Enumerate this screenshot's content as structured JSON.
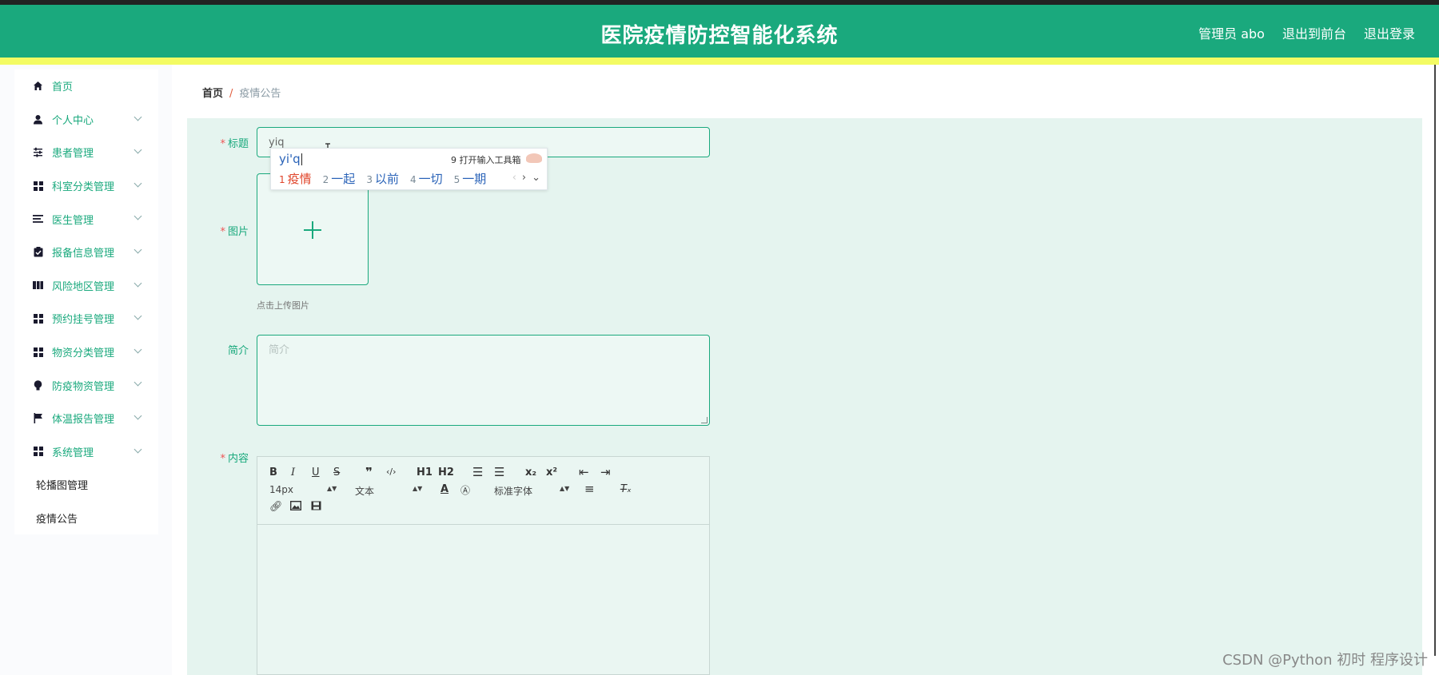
{
  "header": {
    "title": "医院疫情防控智能化系统",
    "nav": [
      "管理员 abo",
      "退出到前台",
      "退出登录"
    ]
  },
  "sidebar": {
    "items": [
      {
        "label": "首页",
        "icon": "home-icon",
        "has_children": false
      },
      {
        "label": "个人中心",
        "icon": "user-icon",
        "has_children": true
      },
      {
        "label": "患者管理",
        "icon": "sliders-icon",
        "has_children": true
      },
      {
        "label": "科室分类管理",
        "icon": "grid-icon",
        "has_children": true
      },
      {
        "label": "医生管理",
        "icon": "list-icon",
        "has_children": true
      },
      {
        "label": "报备信息管理",
        "icon": "clipboard-check-icon",
        "has_children": true
      },
      {
        "label": "风险地区管理",
        "icon": "map-icon",
        "has_children": true
      },
      {
        "label": "预约挂号管理",
        "icon": "grid-icon",
        "has_children": true
      },
      {
        "label": "物资分类管理",
        "icon": "grid-icon",
        "has_children": true
      },
      {
        "label": "防疫物资管理",
        "icon": "bulb-icon",
        "has_children": true
      },
      {
        "label": "体温报告管理",
        "icon": "flag-icon",
        "has_children": true
      },
      {
        "label": "系统管理",
        "icon": "grid-icon",
        "has_children": true
      }
    ],
    "sub_items": [
      "轮播图管理",
      "疫情公告"
    ]
  },
  "breadcrumb": {
    "home": "首页",
    "separator": "/",
    "current": "疫情公告"
  },
  "form": {
    "title_label": "标题",
    "title_value": "yiq",
    "image_label": "图片",
    "upload_tip": "点击上传图片",
    "summary_label": "简介",
    "summary_placeholder": "简介",
    "content_label": "内容",
    "required_mark": "*"
  },
  "editor": {
    "font_size": "14px",
    "block_type": "文本",
    "font_family": "标准字体",
    "h1": "H1",
    "h2": "H2"
  },
  "ime": {
    "composition": "yi'q",
    "tools_label": "9 打开输入工具箱",
    "candidates": [
      {
        "n": "1",
        "text": "疫情"
      },
      {
        "n": "2",
        "text": "一起"
      },
      {
        "n": "3",
        "text": "以前"
      },
      {
        "n": "4",
        "text": "一切"
      },
      {
        "n": "5",
        "text": "一期"
      }
    ]
  },
  "watermark": "CSDN @Python 初时 程序设计",
  "colors": {
    "brand": "#1aa97d",
    "accent_bar": "#f3fb63",
    "panel": "#e5f4ef"
  }
}
